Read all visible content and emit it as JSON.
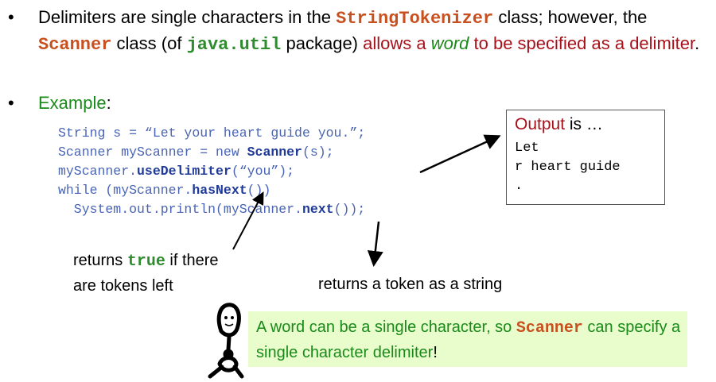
{
  "bullet1": {
    "dot": "•",
    "part1": "Delimiters are single characters in the ",
    "code1": "StringTokenizer",
    "part2": " class; however, the ",
    "code2": "Scanner",
    "part3": " class (of ",
    "code3": "java.util",
    "part4": " package) ",
    "part5": "allows a ",
    "part6": "word",
    "part7": " to be specified as a delimiter",
    "part8": "."
  },
  "bullet2": {
    "dot": "•",
    "label": "Example",
    "colon": ":"
  },
  "code": {
    "line1": "String s = “Let your heart guide you.”;",
    "line2a": "Scanner myScanner = new ",
    "line2b": "Scanner",
    "line2c": "(s);",
    "line3a": "myScanner.",
    "line3b": "useDelimiter",
    "line3c": "(“you”);",
    "line4a": "while (myScanner.",
    "line4b": "hasNext",
    "line4c": "())",
    "line5a": "  System.out.println(myScanner.",
    "line5b": "next",
    "line5c": "());"
  },
  "output": {
    "title_word": "Output",
    "title_rest": " is …",
    "lines": "Let\nr heart guide\n."
  },
  "notes": {
    "hasnext_part1": "returns ",
    "hasnext_code": "true",
    "hasnext_part2": " if there",
    "hasnext_line2": "are tokens left",
    "next_note": "returns a token as a string"
  },
  "tip": {
    "part1": "A word can be a single character, so ",
    "code": "Scanner",
    "part2": " can specify a single character delimiter",
    "part3": "!"
  },
  "colors": {
    "code_orange": "#c8501e",
    "code_green": "#2e8b2e",
    "dark_red": "#a8101a",
    "green": "#1a8a1a",
    "code_blue": "#4a64b4",
    "tip_background": "#e8fccc"
  },
  "icons": {
    "mascot": "stick-figure-mascot-icon",
    "arrows": "arrow-icon"
  }
}
